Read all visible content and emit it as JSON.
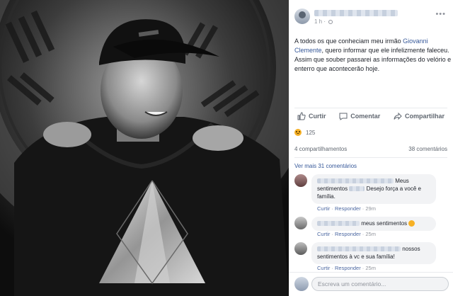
{
  "post": {
    "time": "1 h",
    "text_before": "A todos os que conheciam meu irmão ",
    "text_link": "Giovanni Clemente",
    "text_after": ", quero informar que ele infelizmente faleceu. Assim que souber passarei as informações do velório e enterro que acontecerão hoje."
  },
  "actions": {
    "like": "Curtir",
    "comment": "Comentar",
    "share": "Compartilhar"
  },
  "stats": {
    "reactions_count": "125",
    "shares": "4 compartilhamentos",
    "comments": "38 comentários"
  },
  "comments_section": {
    "see_more": "Ver mais 31 comentários",
    "items": [
      {
        "text_a": "Meus",
        "text_b": "sentimentos",
        "text_c": "Desejo força a você e família.",
        "like": "Curtir",
        "reply": "Responder",
        "time": "29m"
      },
      {
        "text_a": "meus sentimentos",
        "like": "Curtir",
        "reply": "Responder",
        "time": "25m"
      },
      {
        "text_a": "nossos",
        "text_b": "sentimentos à vc e sua família!",
        "like": "Curtir",
        "reply": "Responder",
        "time": "25m"
      }
    ]
  },
  "composer": {
    "placeholder": "Escreva um comentário..."
  },
  "colors": {
    "link": "#365899",
    "muted": "#90949c",
    "bubble": "#f2f3f5",
    "sad_reaction": "#f7b125"
  }
}
